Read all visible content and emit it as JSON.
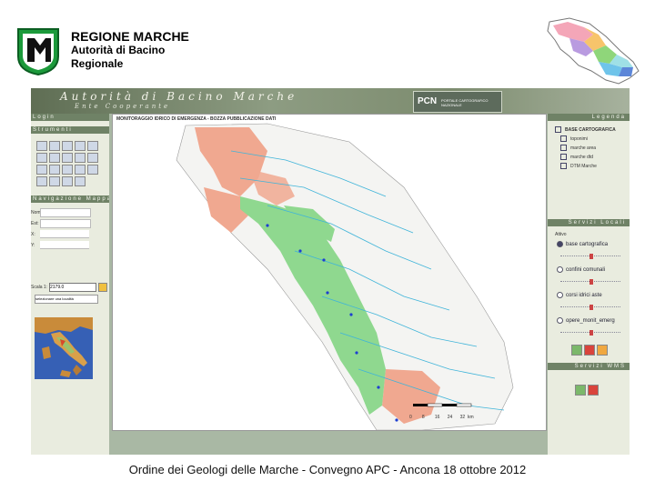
{
  "header": {
    "title": "REGIONE MARCHE",
    "subtitle": "Autorità di Bacino Regionale"
  },
  "footer": {
    "text": "Ordine dei Geologi delle Marche - Convegno APC - Ancona 18 ottobre 2012"
  },
  "app": {
    "banner_title": "Autorità di Bacino Marche",
    "banner_subtitle": "Ente Cooperante",
    "left_panel": {
      "login_header": "Login",
      "tools_header": "Strumenti",
      "nav_header": "Navigazione Mappa",
      "field_labels": [
        "Nom:",
        "Est:",
        "X:",
        "Y:"
      ],
      "scale_label": "Scala 1:",
      "scale_value": "2179.0",
      "select_value": "selezionare una località"
    },
    "map": {
      "title": "MONITORAGGIO IDRICO DI EMERGENZA - BOZZA PUBBLICAZIONE DATI",
      "scale_ticks": [
        "0",
        "8",
        "16",
        "24",
        "32",
        "km"
      ]
    },
    "right_panel": {
      "legend_header": "Legenda",
      "legend_title": "BASE CARTOGRAFICA",
      "legend_items": [
        "toponimi",
        "marche area",
        "marche dtd",
        "DTM Marche"
      ],
      "local_services_header": "Servizi Locali",
      "active_label": "Attivo",
      "layers": [
        "base cartografica",
        "confini comunali",
        "corsi idrici aste",
        "opere_monit_emerg"
      ],
      "wms_header": "Servizi WMS"
    }
  },
  "colors": {
    "panel_header": "#6f8266",
    "panel_bg": "#e9ecdf",
    "map_green": "#8fd88f",
    "map_salmon": "#f0a890",
    "river_blue": "#3fb4d9"
  }
}
